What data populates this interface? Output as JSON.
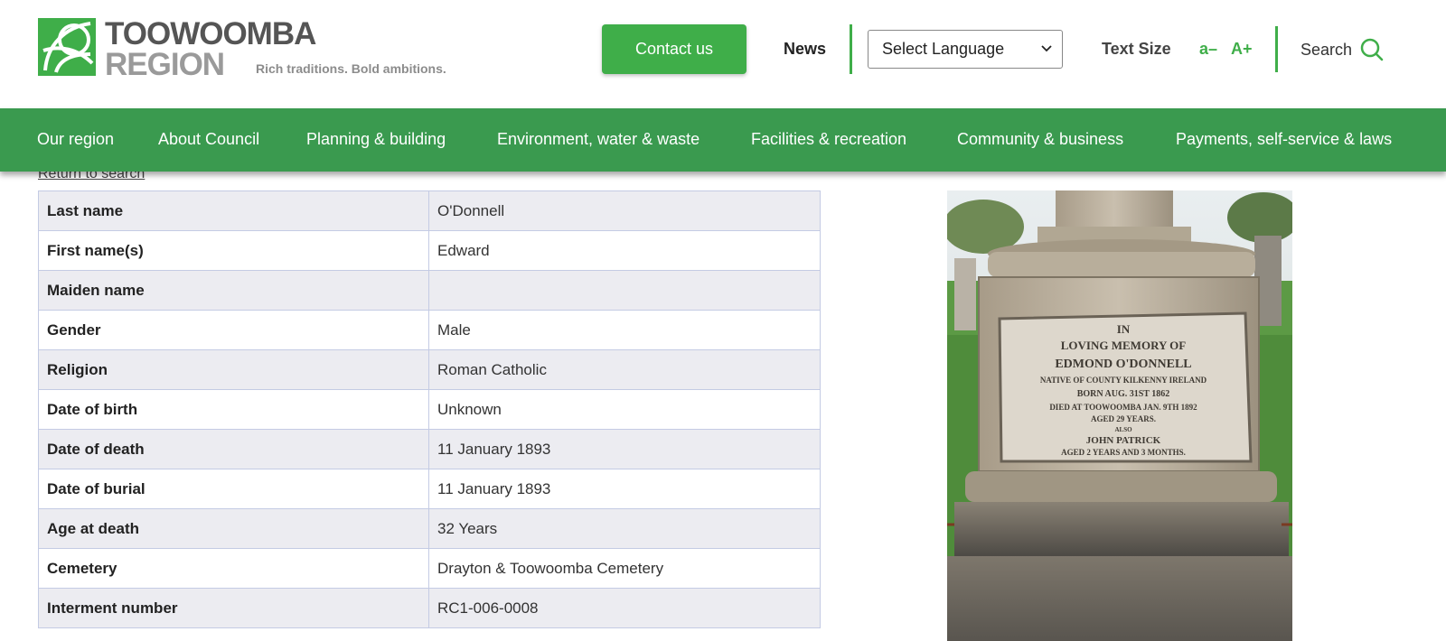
{
  "header": {
    "logo_line1": "TOOWOOMBA",
    "logo_line2": "REGION",
    "logo_tagline": "Rich traditions. Bold ambitions.",
    "contact_label": "Contact us",
    "news_label": "News",
    "language_select": "Select Language",
    "text_size_label": "Text Size",
    "text_smaller": "a–",
    "text_larger": "A+",
    "search_label": "Search"
  },
  "nav": {
    "items": [
      {
        "label": "Our region"
      },
      {
        "label": "About Council"
      },
      {
        "label": "Planning & building"
      },
      {
        "label": "Environment, water & waste"
      },
      {
        "label": "Facilities & recreation"
      },
      {
        "label": "Community & business"
      },
      {
        "label": "Payments, self-service & laws"
      }
    ]
  },
  "content": {
    "return_link": "Return to search",
    "rows": [
      {
        "label": "Last name",
        "value": "O'Donnell"
      },
      {
        "label": "First name(s)",
        "value": "Edward"
      },
      {
        "label": "Maiden name",
        "value": ""
      },
      {
        "label": "Gender",
        "value": "Male"
      },
      {
        "label": "Religion",
        "value": "Roman Catholic"
      },
      {
        "label": "Date of birth",
        "value": "Unknown"
      },
      {
        "label": "Date of death",
        "value": "11 January 1893"
      },
      {
        "label": "Date of burial",
        "value": "11 January 1893"
      },
      {
        "label": "Age at death",
        "value": "32 Years"
      },
      {
        "label": "Cemetery",
        "value": "Drayton & Toowoomba Cemetery"
      },
      {
        "label": "Interment number",
        "value": "RC1-006-0008"
      }
    ]
  },
  "photo": {
    "inscription": [
      "IN",
      "LOVING MEMORY OF",
      "EDMOND O'DONNELL",
      "NATIVE OF COUNTY KILKENNY IRELAND",
      "BORN AUG. 31ST 1862",
      "DIED AT TOOWOOMBA JAN. 9TH 1892",
      "AGED 29 YEARS.",
      "ALSO",
      "JOHN PATRICK",
      "AGED 2 YEARS AND 3 MONTHS."
    ]
  },
  "colors": {
    "brand_green": "#3fae49",
    "nav_green": "#3a9a4f",
    "row_shade": "#ececf1",
    "table_border": "#c4cbe4"
  }
}
